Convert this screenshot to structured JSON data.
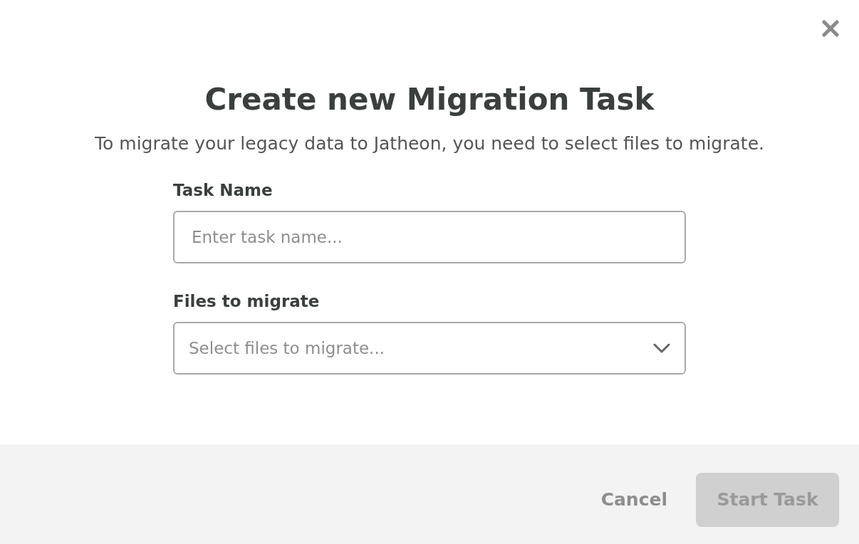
{
  "dialog": {
    "title": "Create new Migration Task",
    "description": "To migrate your legacy data to Jatheon, you need to select files to migrate.",
    "fields": [
      {
        "kind": "text",
        "label": "Task Name",
        "placeholder": "Enter task name..."
      },
      {
        "kind": "select",
        "label": "Files to migrate",
        "placeholder": "Select files to migrate..."
      }
    ],
    "buttons": [
      {
        "kind": "link",
        "label": "Cancel",
        "disabled": false
      },
      {
        "kind": "primary",
        "label": "Start Task",
        "disabled": true
      }
    ]
  }
}
